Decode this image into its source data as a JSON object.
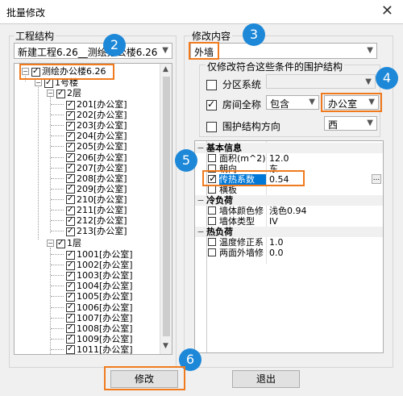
{
  "window": {
    "title": "批量修改",
    "close_glyph": "✕"
  },
  "left_group": {
    "title": "工程结构",
    "project_combo": "新建工程6.26__测绘办公楼6.26",
    "tree": {
      "root": "测绘办公楼6.26",
      "building": "1号楼",
      "floor2": "2层",
      "floor2_rooms": [
        "201[办公室]",
        "202[办公室]",
        "203[办公室]",
        "204[办公室]",
        "205[办公室]",
        "206[办公室]",
        "207[办公室]",
        "208[办公室]",
        "209[办公室]",
        "210[办公室]",
        "211[办公室]",
        "212[办公室]",
        "213[办公室]"
      ],
      "floor1": "1层",
      "floor1_rooms": [
        "1001[办公室]",
        "1002[办公室]",
        "1003[办公室]",
        "1004[办公室]",
        "1005[办公室]",
        "1006[办公室]",
        "1007[办公室]",
        "1008[办公室]",
        "1009[办公室]",
        "1011[办公室]"
      ]
    }
  },
  "right_group": {
    "title": "修改内容",
    "content_combo": "外墙",
    "filter_title": "仅修改符合这些条件的围护结构",
    "zone_label": "分区系统",
    "room_name_label": "房间全称",
    "room_name_op": "包含",
    "room_name_value": "办公室",
    "direction_label": "围护结构方向",
    "direction_value": "西"
  },
  "properties": {
    "sections": [
      {
        "title": "基本信息",
        "rows": [
          {
            "name": "面积(m^2)",
            "value": "12.0"
          },
          {
            "name": "朝向",
            "value": "东"
          },
          {
            "name": "传热系数",
            "value": "0.54"
          },
          {
            "name": "横板",
            "value": ""
          }
        ]
      },
      {
        "title": "冷负荷",
        "rows": [
          {
            "name": "墙体颜色修",
            "value": "浅色0.94"
          },
          {
            "name": "墙体类型",
            "value": "IV"
          }
        ]
      },
      {
        "title": "热负荷",
        "rows": [
          {
            "name": "温度修正系",
            "value": "1.0"
          },
          {
            "name": "两面外墙修",
            "value": "0.0"
          }
        ]
      }
    ],
    "more_button": "..."
  },
  "buttons": {
    "modify": "修改",
    "exit": "退出"
  },
  "badges": [
    "2",
    "3",
    "4",
    "5",
    "6"
  ],
  "colors": {
    "highlight": "#f07b1f",
    "badge": "#1e88d8",
    "selection": "#0078d7"
  }
}
